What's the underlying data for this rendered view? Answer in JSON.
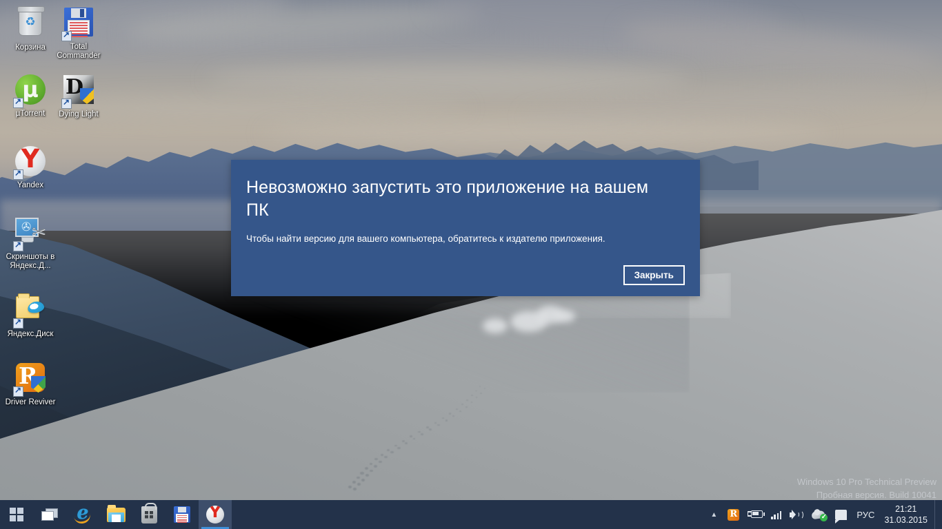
{
  "desktop": {
    "icons": [
      {
        "label": "Корзина",
        "icon": "recycle-bin-icon",
        "shortcut": false
      },
      {
        "label": "Total Commander",
        "icon": "floppy-disk-icon",
        "shortcut": true
      },
      {
        "label": "µTorrent",
        "icon": "utorrent-icon",
        "shortcut": true
      },
      {
        "label": "Dying Light",
        "icon": "dying-light-icon",
        "shortcut": true
      },
      {
        "label": "Yandex",
        "icon": "yandex-browser-icon",
        "shortcut": true
      },
      {
        "label": "Скриншоты в Яндекс.Д...",
        "icon": "screenshot-scissors-icon",
        "shortcut": true
      },
      {
        "label": "Яндекс.Диск",
        "icon": "yandex-disk-folder-icon",
        "shortcut": true
      },
      {
        "label": "Driver Reviver",
        "icon": "driver-reviver-icon",
        "shortcut": true
      }
    ]
  },
  "dialog": {
    "title": "Невозможно запустить это приложение на вашем ПК",
    "subtitle": "Чтобы найти версию для вашего компьютера, обратитесь к издателю приложения.",
    "close_label": "Закрыть",
    "background_color": "#35568a"
  },
  "watermark": {
    "line1": "Windows 10 Pro Technical Preview",
    "line2": "Пробная версия. Build 10041"
  },
  "taskbar": {
    "background_color": "#23324a",
    "accent_color": "#3f8fd8",
    "buttons": [
      {
        "name": "start-button",
        "icon": "windows-logo-icon"
      },
      {
        "name": "task-view-button",
        "icon": "task-view-icon"
      },
      {
        "name": "internet-explorer-button",
        "icon": "internet-explorer-icon"
      },
      {
        "name": "file-explorer-button",
        "icon": "folder-icon"
      },
      {
        "name": "store-button",
        "icon": "store-bag-icon"
      },
      {
        "name": "total-commander-button",
        "icon": "floppy-disk-icon"
      },
      {
        "name": "yandex-browser-button",
        "icon": "yandex-browser-icon",
        "active": true
      }
    ],
    "tray": {
      "expand_icon": "chevron-up-icon",
      "items": [
        {
          "name": "driver-reviver-tray-icon",
          "icon": "driver-reviver-icon"
        },
        {
          "name": "battery-tray-icon",
          "icon": "battery-charging-icon"
        },
        {
          "name": "network-tray-icon",
          "icon": "signal-bars-icon"
        },
        {
          "name": "volume-tray-icon",
          "icon": "speaker-icon"
        },
        {
          "name": "yandex-disk-tray-icon",
          "icon": "cloud-check-icon"
        },
        {
          "name": "notifications-tray-icon",
          "icon": "notification-flag-icon"
        }
      ],
      "language": "РУС",
      "time": "21:21",
      "date": "31.03.2015"
    }
  }
}
